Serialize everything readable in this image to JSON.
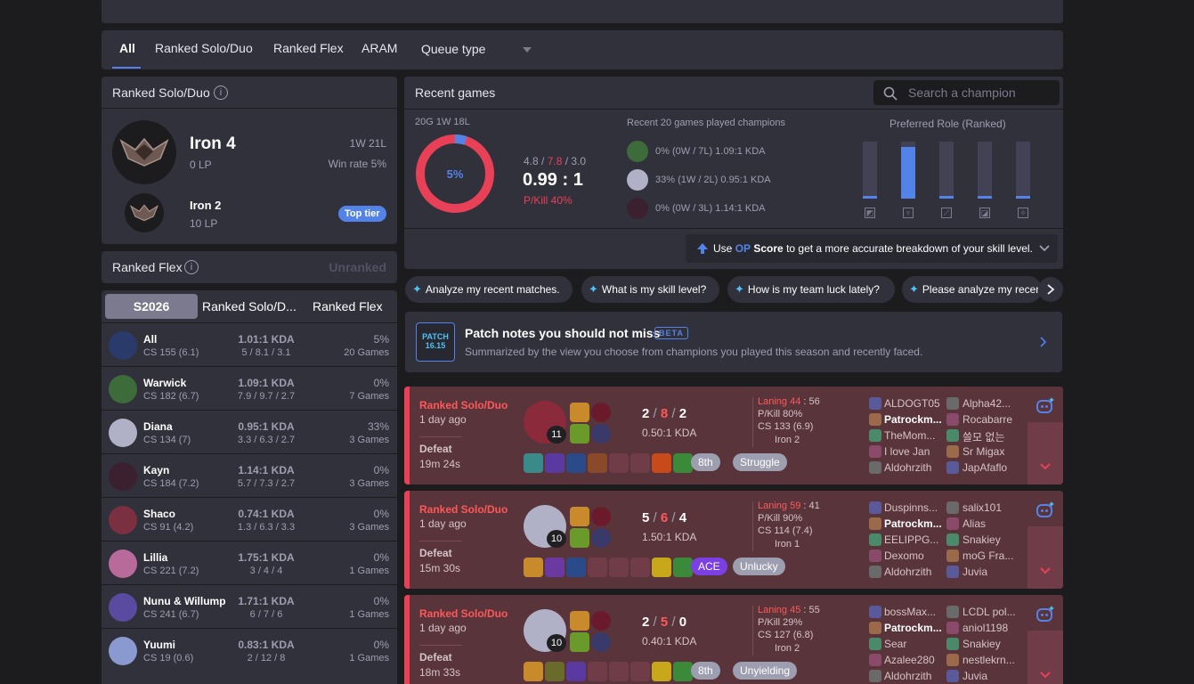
{
  "nav": {
    "tabs": [
      "All",
      "Ranked Solo/Duo",
      "Ranked Flex",
      "ARAM"
    ],
    "queue_select": "Queue type"
  },
  "solo": {
    "title": "Ranked Solo/Duo",
    "info": "i",
    "tier": "Iron 4",
    "lp": "0 LP",
    "record": "1W 21L",
    "winrate": "Win rate 5%",
    "top_tier": "Iron 2",
    "top_lp": "10 LP",
    "top_badge": "Top tier"
  },
  "flex": {
    "title": "Ranked Flex",
    "info": "i",
    "status": "Unranked"
  },
  "season": {
    "tabs": [
      "S2026",
      "Ranked Solo/D...",
      "Ranked Flex"
    ],
    "rows": [
      {
        "name": "All",
        "cs": "CS 155 (6.1)",
        "kda": "1.01:1 KDA",
        "kdad": "5 / 8.1 / 3.1",
        "wr": "5%",
        "games": "20 Games",
        "color": "#2a3a6a"
      },
      {
        "name": "Warwick",
        "cs": "CS 182 (6.7)",
        "kda": "1.09:1 KDA",
        "kdad": "7.9 / 9.7 / 2.7",
        "wr": "0%",
        "games": "7 Games",
        "color": "#3e6b3a"
      },
      {
        "name": "Diana",
        "cs": "CS 134 (7)",
        "kda": "0.95:1 KDA",
        "kdad": "3.3 / 6.3 / 2.7",
        "wr": "33%",
        "games": "3 Games",
        "color": "#b0b0c6"
      },
      {
        "name": "Kayn",
        "cs": "CS 184 (7.2)",
        "kda": "1.14:1 KDA",
        "kdad": "5.7 / 7.3 / 2.7",
        "wr": "0%",
        "games": "3 Games",
        "color": "#3b2030"
      },
      {
        "name": "Shaco",
        "cs": "CS 91 (4.2)",
        "kda": "0.74:1 KDA",
        "kdad": "1.3 / 6.3 / 3.3",
        "wr": "0%",
        "games": "3 Games",
        "color": "#7a3040"
      },
      {
        "name": "Lillia",
        "cs": "CS 221 (7.2)",
        "kda": "1.75:1 KDA",
        "kdad": "3 / 4 / 4",
        "wr": "0%",
        "games": "1 Games",
        "color": "#b86a9a"
      },
      {
        "name": "Nunu & Willump",
        "cs": "CS 241 (6.7)",
        "kda": "1.71:1 KDA",
        "kdad": "6 / 7 / 6",
        "wr": "0%",
        "games": "1 Games",
        "color": "#5a4aa0"
      },
      {
        "name": "Yuumi",
        "cs": "CS 19 (0.6)",
        "kda": "0.83:1 KDA",
        "kdad": "2 / 12 / 8",
        "wr": "0%",
        "games": "1 Games",
        "color": "#8a9ad0"
      }
    ]
  },
  "recent": {
    "title": "Recent games",
    "search_placeholder": "Search a champion",
    "record": "20G 1W 18L",
    "winrate_pct": 5,
    "winrate_label": "5%",
    "avg_kda_k": "4.8",
    "avg_kda_d": "7.8",
    "avg_kda_a": "3.0",
    "kda_ratio": "0.99 : 1",
    "pkill": "P/Kill 40%",
    "champs_title": "Recent 20 games played champions",
    "champs": [
      {
        "wr": "0%",
        "record": "(0W / 7L)",
        "kda": "1.09:1 KDA",
        "color": "#3e6b3a"
      },
      {
        "wr": "33%",
        "record": "(1W / 2L)",
        "kda": "0.95:1 KDA",
        "color": "#b0b0c6"
      },
      {
        "wr": "0%",
        "record": "(0W / 3L)",
        "kda": "1.14:1 KDA",
        "color": "#3b2030"
      }
    ],
    "role_title": "Preferred Role (Ranked)",
    "roles": [
      {
        "name": "top-icon",
        "pct": 0.05
      },
      {
        "name": "jungle-icon",
        "pct": 0.9
      },
      {
        "name": "mid-icon",
        "pct": 0.0
      },
      {
        "name": "adc-icon",
        "pct": 0.0
      },
      {
        "name": "support-icon",
        "pct": 0.05
      }
    ],
    "op_prefix": "Use ",
    "op_word": "OP",
    "op_score": "Score",
    "op_suffix": " to get a more accurate breakdown of your skill level."
  },
  "chips": [
    "Analyze my recent matches.",
    "What is my skill level?",
    "How is my team luck lately?",
    "Please analyze my recen"
  ],
  "patch": {
    "badge_top": "PATCH",
    "badge_num": "16.15",
    "title": "Patch notes you should not miss",
    "beta": "BETA",
    "desc": "Summarized by the view you choose from champions you played this season and recently faced."
  },
  "matches": [
    {
      "queue": "Ranked Solo/Duo",
      "ago": "1 day ago",
      "result": "Defeat",
      "duration": "19m 24s",
      "level": "11",
      "champ_color": "#8a2a3a",
      "k": "2",
      "d": "8",
      "a": "2",
      "kda_ratio": "0.50:1 KDA",
      "laning_label": "Laning 44",
      "laning_opp": "56",
      "pkill": "P/Kill 80%",
      "cs": "CS 133 (6.9)",
      "tier": "Iron 2",
      "tags": [
        {
          "text": "8th",
          "kind": "grey"
        },
        {
          "text": "Struggle",
          "kind": "bad"
        }
      ],
      "items": [
        "#3a8a8a",
        "#5a3aa0",
        "#2a4a8a",
        "#8a4a2a",
        "",
        "",
        "#c84a1a",
        "#3a8a3a"
      ],
      "team1": [
        "ALDOGT05",
        "Patrockm...",
        "TheMom...",
        "I love Jan",
        "Aldohrzith"
      ],
      "team2": [
        "Alpha42...",
        "Rocabarre",
        "쓸모 없는",
        "Sr Migax",
        "JapAfaflo"
      ]
    },
    {
      "queue": "Ranked Solo/Duo",
      "ago": "1 day ago",
      "result": "Defeat",
      "duration": "15m 30s",
      "level": "10",
      "champ_color": "#b0b0c6",
      "k": "5",
      "d": "6",
      "a": "4",
      "kda_ratio": "1.50:1 KDA",
      "laning_label": "Laning 59",
      "laning_opp": "41",
      "pkill": "P/Kill 90%",
      "cs": "CS 114 (7.4)",
      "tier": "Iron 1",
      "tags": [
        {
          "text": "ACE",
          "kind": "ace"
        },
        {
          "text": "Unlucky",
          "kind": "bad"
        }
      ],
      "items": [
        "#c88a2a",
        "#6a3aa0",
        "#2a4a8a",
        "",
        "",
        "",
        "#c8a81a",
        "#3a8a3a"
      ],
      "team1": [
        "Duspinns...",
        "Patrockm...",
        "EELIPPG...",
        "Dexomo",
        "Aldohrzith"
      ],
      "team2": [
        "salix101",
        "Alias",
        "Snakiey",
        "moG Fra...",
        "Juvia"
      ]
    },
    {
      "queue": "Ranked Solo/Duo",
      "ago": "1 day ago",
      "result": "Defeat",
      "duration": "18m 33s",
      "level": "10",
      "champ_color": "#b0b0c6",
      "k": "2",
      "d": "5",
      "a": "0",
      "kda_ratio": "0.40:1 KDA",
      "laning_label": "Laning 45",
      "laning_opp": "55",
      "pkill": "P/Kill 29%",
      "cs": "CS 127 (6.8)",
      "tier": "Iron 2",
      "tags": [
        {
          "text": "8th",
          "kind": "grey"
        },
        {
          "text": "Unyielding",
          "kind": "bad"
        }
      ],
      "items": [
        "#c88a2a",
        "#6a6a2a",
        "#5a3aa0",
        "",
        "",
        "",
        "#c8a81a",
        "#3a8a3a"
      ],
      "team1": [
        "bossMax...",
        "Patrockm...",
        "Sear",
        "Azalee280",
        "Aldohrzith"
      ],
      "team2": [
        "LCDL pol...",
        "aniol1198",
        "Snakiey",
        "nestlekrn...",
        "Juvia"
      ]
    }
  ],
  "colors": {
    "accent": "#5383e8",
    "loss": "#e84057",
    "loss_bg": "#59343b",
    "panel": "#31313c",
    "bg": "#1c1c1f"
  }
}
